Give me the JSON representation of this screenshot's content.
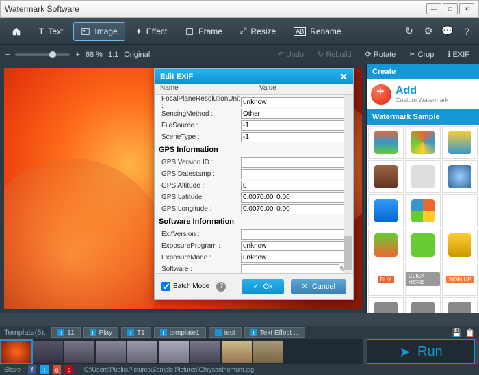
{
  "window": {
    "title": "Watermark Software"
  },
  "toolbar": {
    "home": "",
    "text": "Text",
    "image": "Image",
    "effect": "Effect",
    "frame": "Frame",
    "resize": "Resize",
    "rename": "Rename"
  },
  "zoom": {
    "percent": "68 %",
    "ratio": "1:1",
    "original": "Original",
    "undo": "Undo",
    "rebuild": "Rebuild",
    "rotate": "Rotate",
    "crop": "Crop",
    "exif": "EXIF"
  },
  "rightpanel": {
    "create": "Create",
    "add1": "Add",
    "add2": "Custom Watermark",
    "sample_header": "Watermark Sample",
    "samples": [
      {
        "name": "pie-3d",
        "bg": "linear-gradient(#e63,#39c 50%,#6c3)"
      },
      {
        "name": "pie-flat",
        "bg": "conic-gradient(#e63,#39c,#fc3,#6c3,#e63)"
      },
      {
        "name": "tags",
        "bg": "linear-gradient(#fc3,#39c)"
      },
      {
        "name": "servers",
        "bg": "linear-gradient(#964,#632)"
      },
      {
        "name": "cart",
        "bg": "#ddd"
      },
      {
        "name": "globe",
        "bg": "radial-gradient(#9cf,#369)"
      },
      {
        "name": "tag-blue",
        "bg": "linear-gradient(#39f,#06c)"
      },
      {
        "name": "pie-quarter",
        "bg": "conic-gradient(#e63 0 25%,#fc3 0 50%,#6c3 0 75%,#39c 0)"
      },
      {
        "name": "envelope",
        "bg": "#fff"
      },
      {
        "name": "tag-green",
        "bg": "linear-gradient(#6c3,#e63)"
      },
      {
        "name": "basket",
        "bg": "#6c3"
      },
      {
        "name": "coin-stack",
        "bg": "linear-gradient(#fc3,#c90)"
      },
      {
        "name": "buy",
        "bg": "#e63",
        "label": "BUY"
      },
      {
        "name": "click",
        "bg": "#999",
        "label": "CLICK HERE"
      },
      {
        "name": "signup",
        "bg": "#f73",
        "label": "SIGN UP"
      },
      {
        "name": "camera",
        "bg": "#888"
      },
      {
        "name": "recycle",
        "bg": "#888"
      },
      {
        "name": "roll",
        "bg": "#888"
      }
    ]
  },
  "templates": {
    "label": "Template(6):",
    "items": [
      "11",
      "Play",
      "T1",
      "template1",
      "test",
      "Text Effect ..."
    ]
  },
  "thumbs": [
    {
      "bg": "radial-gradient(circle,#ff6a1a,#8b1a05)",
      "sel": true
    },
    {
      "bg": "linear-gradient(#556,#334)"
    },
    {
      "bg": "linear-gradient(#778,#445)"
    },
    {
      "bg": "linear-gradient(#889,#556)"
    },
    {
      "bg": "linear-gradient(#99a,#667)"
    },
    {
      "bg": "linear-gradient(#aab,#778)"
    },
    {
      "bg": "linear-gradient(#778,#445)"
    },
    {
      "bg": "linear-gradient(#cb8,#975)"
    },
    {
      "bg": "linear-gradient(#a97,#764)"
    }
  ],
  "run": "Run",
  "status": {
    "share": "Share :",
    "path": "C:\\Users\\Public\\Pictures\\Sample Pictures\\Chrysanthemum.jpg"
  },
  "dialog": {
    "title": "Edit EXIF",
    "col_name": "Name",
    "col_value": "Value",
    "rows1": [
      {
        "label": "FocalPlaneResolutionUnit :",
        "value": "unknow"
      },
      {
        "label": "SensingMethod :",
        "value": "Other"
      },
      {
        "label": "FileSource :",
        "value": "-1"
      },
      {
        "label": "SceneType :",
        "value": "-1"
      }
    ],
    "section_gps": "GPS Information",
    "rows_gps": [
      {
        "label": "GPS Version ID :",
        "value": ""
      },
      {
        "label": "GPS Datestamp :",
        "value": ""
      },
      {
        "label": "GPS Altitude :",
        "value": "0"
      },
      {
        "label": "GPS Latitude :",
        "value": "0.0070.00' 0.00\""
      },
      {
        "label": "GPS Longitude :",
        "value": "0.0070.00' 0.00\""
      }
    ],
    "section_sw": "Software Information",
    "rows_sw": [
      {
        "label": "ExifVersion :",
        "value": ""
      },
      {
        "label": "ExposureProgram :",
        "value": "unknow"
      },
      {
        "label": "ExposureMode :",
        "value": "unknow"
      },
      {
        "label": "Software :",
        "value": ""
      }
    ],
    "batch": "Batch Mode",
    "ok": "Ok",
    "cancel": "Cancel"
  }
}
